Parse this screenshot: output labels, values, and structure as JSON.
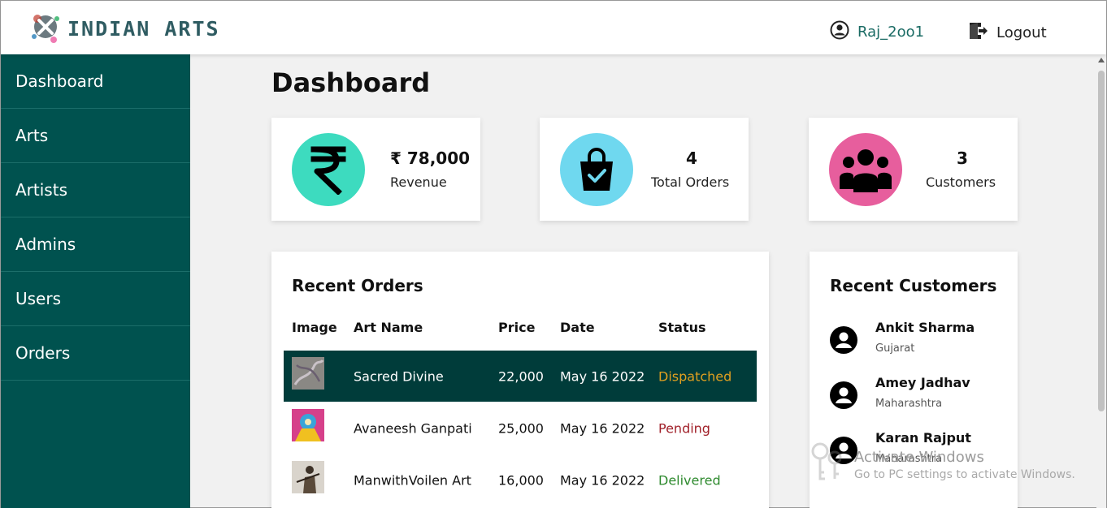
{
  "header": {
    "brand": "INDIAN ARTS",
    "username": "Raj_2oo1",
    "logout_label": "Logout"
  },
  "sidebar": {
    "items": [
      {
        "label": "Dashboard"
      },
      {
        "label": "Arts"
      },
      {
        "label": "Artists"
      },
      {
        "label": "Admins"
      },
      {
        "label": "Users"
      },
      {
        "label": "Orders"
      }
    ]
  },
  "page": {
    "title": "Dashboard"
  },
  "stats": [
    {
      "value": "₹ 78,000",
      "label": "Revenue",
      "icon": "rupee-icon",
      "color": "#3ddbbf"
    },
    {
      "value": "4",
      "label": "Total Orders",
      "icon": "shopping-bag-icon",
      "color": "#6fd8ef"
    },
    {
      "value": "3",
      "label": "Customers",
      "icon": "users-icon",
      "color": "#e75e9d"
    }
  ],
  "recent_orders": {
    "title": "Recent Orders",
    "columns": [
      "Image",
      "Art Name",
      "Price",
      "Date",
      "Status"
    ],
    "rows": [
      {
        "art_name": "Sacred Divine",
        "price": "22,000",
        "date": "May 16 2022",
        "status": "Dispatched",
        "status_color": "#e0a020"
      },
      {
        "art_name": "Avaneesh Ganpati",
        "price": "25,000",
        "date": "May 16 2022",
        "status": "Pending",
        "status_color": "#a1212a"
      },
      {
        "art_name": "ManwithVoilen Art",
        "price": "16,000",
        "date": "May 16 2022",
        "status": "Delivered",
        "status_color": "#2e8a2e"
      }
    ]
  },
  "recent_customers": {
    "title": "Recent Customers",
    "items": [
      {
        "name": "Ankit Sharma",
        "state": "Gujarat"
      },
      {
        "name": "Amey Jadhav",
        "state": "Maharashtra"
      },
      {
        "name": "Karan Rajput",
        "state": "Maharashtra"
      }
    ]
  },
  "watermark": {
    "line1": "Activate Windows",
    "line2": "Go to PC settings to activate Windows."
  },
  "colors": {
    "sidebar": "#00524f",
    "active_row": "#003c3a",
    "accent": "#1a6b64"
  }
}
